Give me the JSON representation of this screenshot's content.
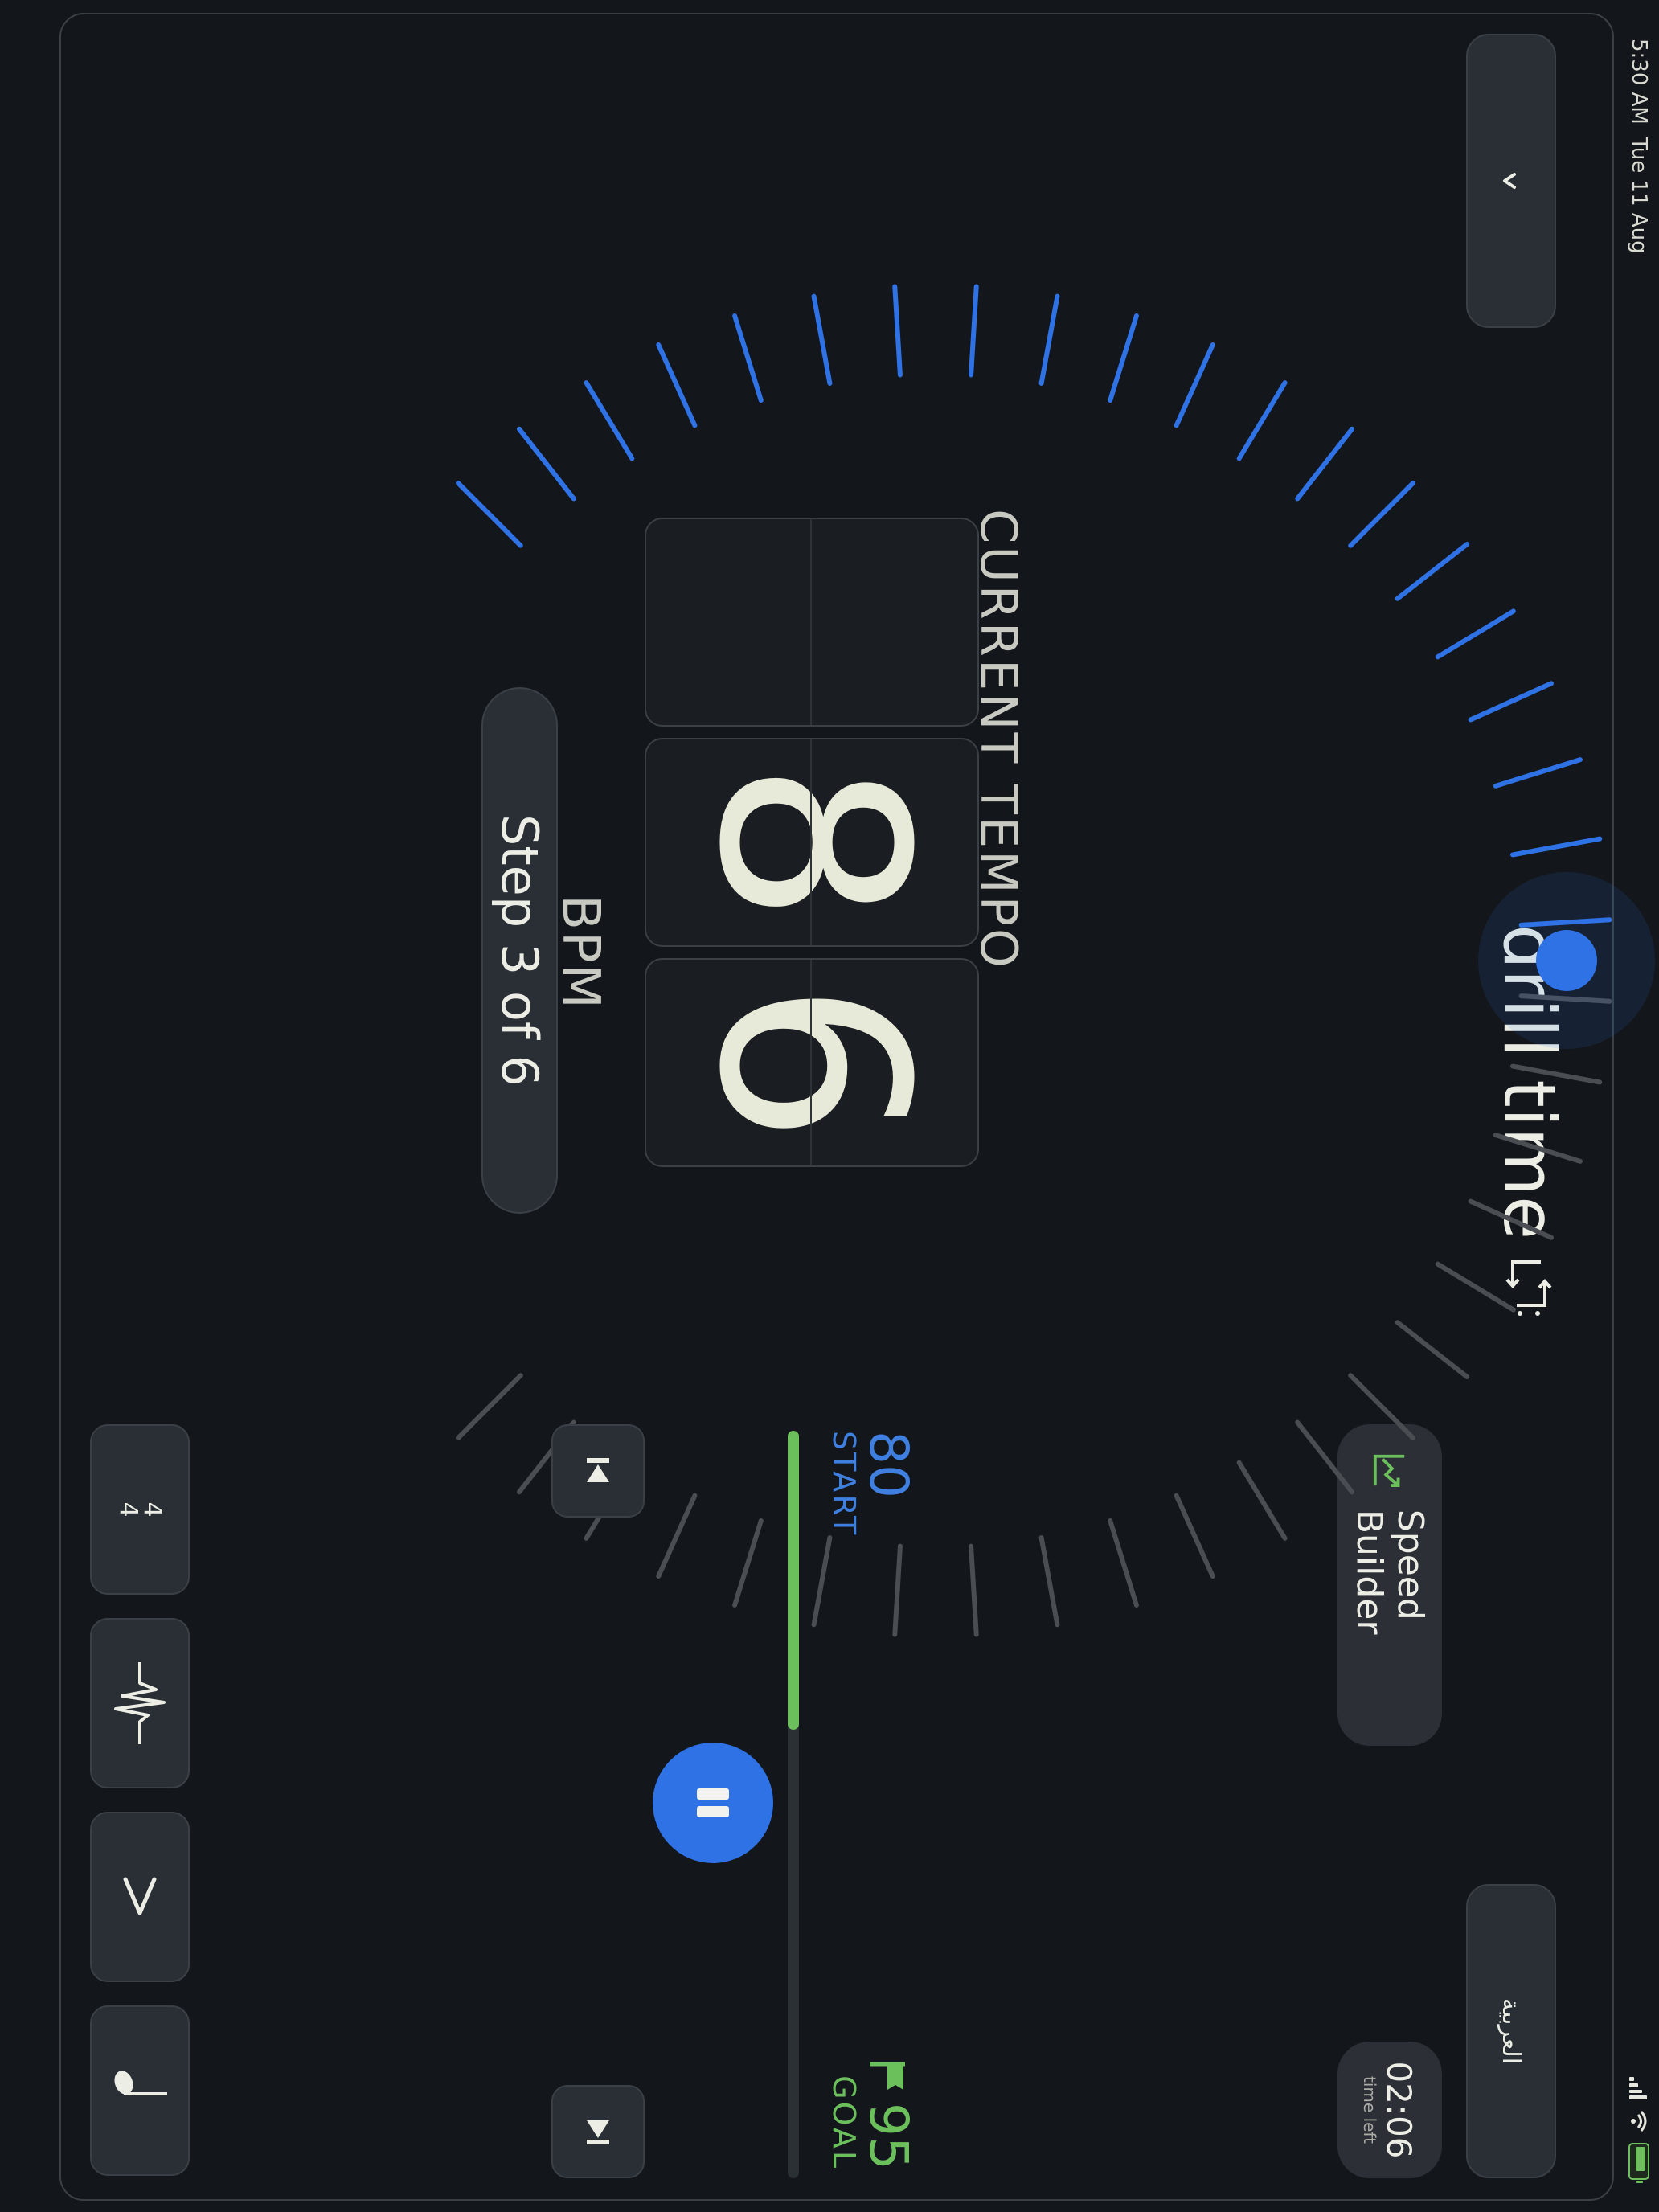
{
  "status": {
    "time": "5:30 AM",
    "date": "Tue 11 Aug"
  },
  "header": {
    "back_icon": "chevron-up-icon",
    "title": "drill time",
    "title_icon": "loop-repeat-icon",
    "language_label": "العربية"
  },
  "speed_builder": {
    "label": "Speed Builder",
    "icon": "trend-chart-icon",
    "time_value": "02:06",
    "time_label": "time left"
  },
  "tempo": {
    "label": "CURRENT TEMPO",
    "digits": [
      "",
      "8",
      "6"
    ],
    "unit": "BPM",
    "step_text": "Step 3 of 6",
    "dial_progress": 0.5
  },
  "progress": {
    "start_value": "80",
    "start_label": "START",
    "goal_value": "95",
    "goal_label": "GOAL",
    "fill_fraction": 0.4
  },
  "colors": {
    "accent": "#2f72e6",
    "goal": "#6cc05c",
    "background": "#13171b"
  },
  "toolbar": {
    "time_signature_top": "4",
    "time_signature_bottom": "4",
    "sound_icon": "waveform-icon",
    "accent_icon": "accent-mark-icon",
    "note_icon": "quarter-note-icon"
  }
}
